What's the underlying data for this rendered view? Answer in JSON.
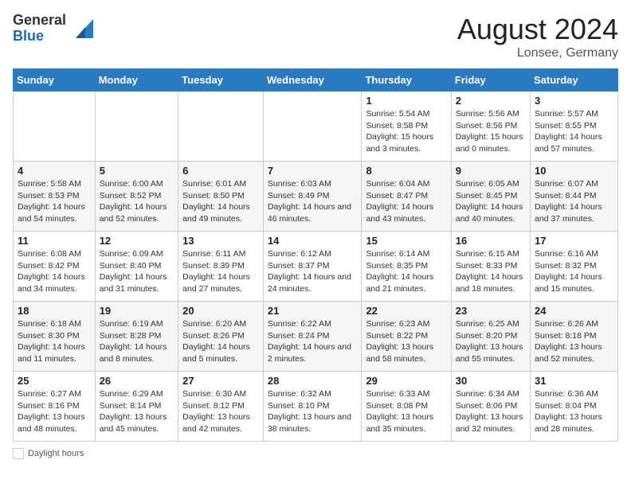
{
  "header": {
    "logo_general": "General",
    "logo_blue": "Blue",
    "month_title": "August 2024",
    "location": "Lonsee, Germany"
  },
  "calendar": {
    "days_of_week": [
      "Sunday",
      "Monday",
      "Tuesday",
      "Wednesday",
      "Thursday",
      "Friday",
      "Saturday"
    ],
    "weeks": [
      [
        {
          "day": "",
          "info": ""
        },
        {
          "day": "",
          "info": ""
        },
        {
          "day": "",
          "info": ""
        },
        {
          "day": "",
          "info": ""
        },
        {
          "day": "1",
          "info": "Sunrise: 5:54 AM\nSunset: 8:58 PM\nDaylight: 15 hours and 3 minutes."
        },
        {
          "day": "2",
          "info": "Sunrise: 5:56 AM\nSunset: 8:56 PM\nDaylight: 15 hours and 0 minutes."
        },
        {
          "day": "3",
          "info": "Sunrise: 5:57 AM\nSunset: 8:55 PM\nDaylight: 14 hours and 57 minutes."
        }
      ],
      [
        {
          "day": "4",
          "info": "Sunrise: 5:58 AM\nSunset: 8:53 PM\nDaylight: 14 hours and 54 minutes."
        },
        {
          "day": "5",
          "info": "Sunrise: 6:00 AM\nSunset: 8:52 PM\nDaylight: 14 hours and 52 minutes."
        },
        {
          "day": "6",
          "info": "Sunrise: 6:01 AM\nSunset: 8:50 PM\nDaylight: 14 hours and 49 minutes."
        },
        {
          "day": "7",
          "info": "Sunrise: 6:03 AM\nSunset: 8:49 PM\nDaylight: 14 hours and 46 minutes."
        },
        {
          "day": "8",
          "info": "Sunrise: 6:04 AM\nSunset: 8:47 PM\nDaylight: 14 hours and 43 minutes."
        },
        {
          "day": "9",
          "info": "Sunrise: 6:05 AM\nSunset: 8:45 PM\nDaylight: 14 hours and 40 minutes."
        },
        {
          "day": "10",
          "info": "Sunrise: 6:07 AM\nSunset: 8:44 PM\nDaylight: 14 hours and 37 minutes."
        }
      ],
      [
        {
          "day": "11",
          "info": "Sunrise: 6:08 AM\nSunset: 8:42 PM\nDaylight: 14 hours and 34 minutes."
        },
        {
          "day": "12",
          "info": "Sunrise: 6:09 AM\nSunset: 8:40 PM\nDaylight: 14 hours and 31 minutes."
        },
        {
          "day": "13",
          "info": "Sunrise: 6:11 AM\nSunset: 8:39 PM\nDaylight: 14 hours and 27 minutes."
        },
        {
          "day": "14",
          "info": "Sunrise: 6:12 AM\nSunset: 8:37 PM\nDaylight: 14 hours and 24 minutes."
        },
        {
          "day": "15",
          "info": "Sunrise: 6:14 AM\nSunset: 8:35 PM\nDaylight: 14 hours and 21 minutes."
        },
        {
          "day": "16",
          "info": "Sunrise: 6:15 AM\nSunset: 8:33 PM\nDaylight: 14 hours and 18 minutes."
        },
        {
          "day": "17",
          "info": "Sunrise: 6:16 AM\nSunset: 8:32 PM\nDaylight: 14 hours and 15 minutes."
        }
      ],
      [
        {
          "day": "18",
          "info": "Sunrise: 6:18 AM\nSunset: 8:30 PM\nDaylight: 14 hours and 11 minutes."
        },
        {
          "day": "19",
          "info": "Sunrise: 6:19 AM\nSunset: 8:28 PM\nDaylight: 14 hours and 8 minutes."
        },
        {
          "day": "20",
          "info": "Sunrise: 6:20 AM\nSunset: 8:26 PM\nDaylight: 14 hours and 5 minutes."
        },
        {
          "day": "21",
          "info": "Sunrise: 6:22 AM\nSunset: 8:24 PM\nDaylight: 14 hours and 2 minutes."
        },
        {
          "day": "22",
          "info": "Sunrise: 6:23 AM\nSunset: 8:22 PM\nDaylight: 13 hours and 58 minutes."
        },
        {
          "day": "23",
          "info": "Sunrise: 6:25 AM\nSunset: 8:20 PM\nDaylight: 13 hours and 55 minutes."
        },
        {
          "day": "24",
          "info": "Sunrise: 6:26 AM\nSunset: 8:18 PM\nDaylight: 13 hours and 52 minutes."
        }
      ],
      [
        {
          "day": "25",
          "info": "Sunrise: 6:27 AM\nSunset: 8:16 PM\nDaylight: 13 hours and 48 minutes."
        },
        {
          "day": "26",
          "info": "Sunrise: 6:29 AM\nSunset: 8:14 PM\nDaylight: 13 hours and 45 minutes."
        },
        {
          "day": "27",
          "info": "Sunrise: 6:30 AM\nSunset: 8:12 PM\nDaylight: 13 hours and 42 minutes."
        },
        {
          "day": "28",
          "info": "Sunrise: 6:32 AM\nSunset: 8:10 PM\nDaylight: 13 hours and 38 minutes."
        },
        {
          "day": "29",
          "info": "Sunrise: 6:33 AM\nSunset: 8:08 PM\nDaylight: 13 hours and 35 minutes."
        },
        {
          "day": "30",
          "info": "Sunrise: 6:34 AM\nSunset: 8:06 PM\nDaylight: 13 hours and 32 minutes."
        },
        {
          "day": "31",
          "info": "Sunrise: 6:36 AM\nSunset: 8:04 PM\nDaylight: 13 hours and 28 minutes."
        }
      ]
    ]
  },
  "footer": {
    "daylight_label": "Daylight hours"
  }
}
